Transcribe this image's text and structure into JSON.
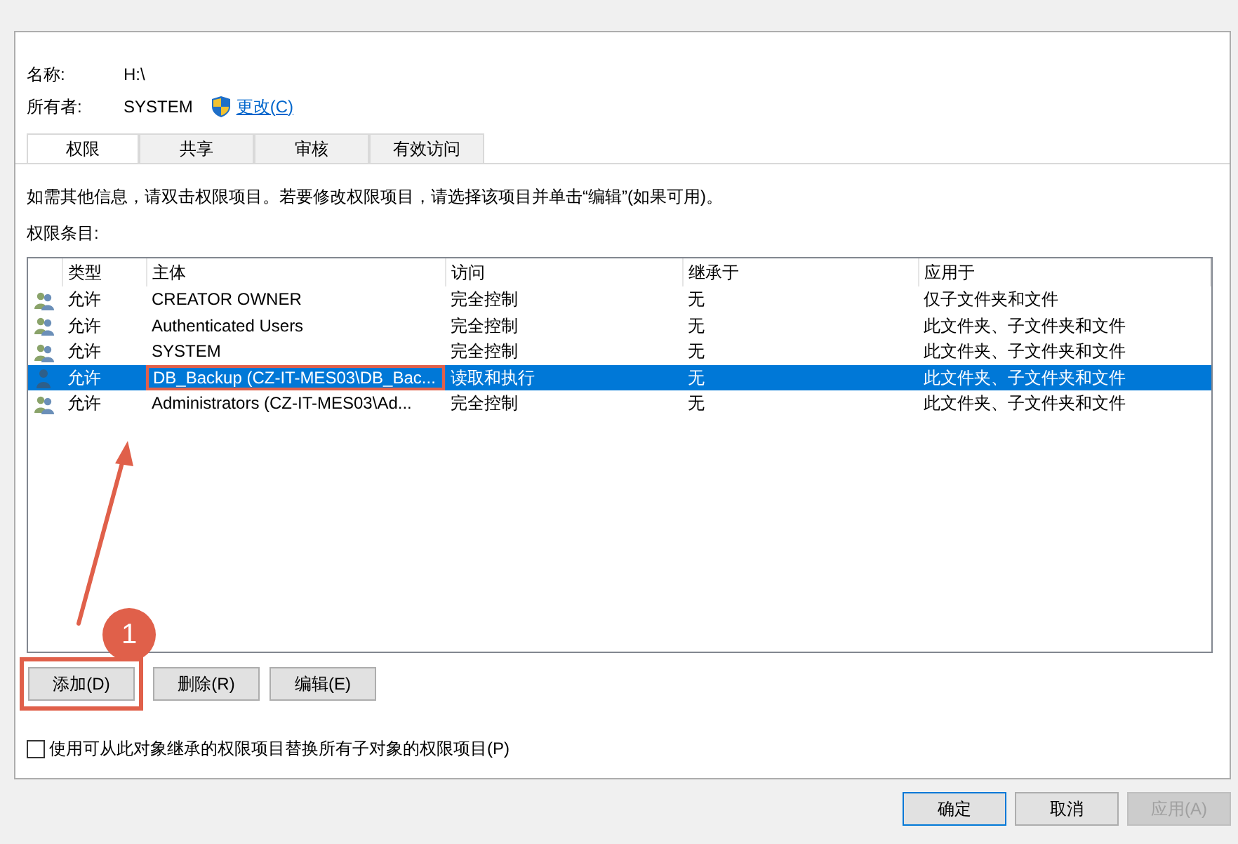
{
  "fields": [
    {
      "label": "名称:",
      "value": "H:\\"
    },
    {
      "label": "所有者:",
      "value": "SYSTEM"
    }
  ],
  "change_link": "更改(C)",
  "tabs": [
    {
      "label": "权限",
      "selected": true
    },
    {
      "label": "共享",
      "selected": false
    },
    {
      "label": "审核",
      "selected": false
    },
    {
      "label": "有效访问",
      "selected": false
    }
  ],
  "info": "如需其他信息，请双击权限项目。若要修改权限项目，请选择该项目并单击“编辑”(如果可用)。",
  "entries_label": "权限条目:",
  "table": {
    "columns": [
      "类型",
      "主体",
      "访问",
      "继承于",
      "应用于"
    ],
    "rows": [
      {
        "kind": "group",
        "type": "允许",
        "principal": "CREATOR OWNER",
        "access": "完全控制",
        "inherited_from": "无",
        "applies_to": "仅子文件夹和文件",
        "selected": false,
        "highlighted": false
      },
      {
        "kind": "group",
        "type": "允许",
        "principal": "Authenticated Users",
        "access": "完全控制",
        "inherited_from": "无",
        "applies_to": "此文件夹、子文件夹和文件",
        "selected": false,
        "highlighted": false
      },
      {
        "kind": "group",
        "type": "允许",
        "principal": "SYSTEM",
        "access": "完全控制",
        "inherited_from": "无",
        "applies_to": "此文件夹、子文件夹和文件",
        "selected": false,
        "highlighted": false
      },
      {
        "kind": "user",
        "type": "允许",
        "principal": "DB_Backup (CZ-IT-MES03\\DB_Bac...",
        "access": "读取和执行",
        "inherited_from": "无",
        "applies_to": "此文件夹、子文件夹和文件",
        "selected": true,
        "highlighted": true
      },
      {
        "kind": "group",
        "type": "允许",
        "principal": "Administrators (CZ-IT-MES03\\Ad...",
        "access": "完全控制",
        "inherited_from": "无",
        "applies_to": "此文件夹、子文件夹和文件",
        "selected": false,
        "highlighted": false
      }
    ]
  },
  "buttons": [
    {
      "label": "添加(D)",
      "highlighted": true
    },
    {
      "label": "删除(R)",
      "highlighted": false
    },
    {
      "label": "编辑(E)",
      "highlighted": false
    }
  ],
  "replace_checkbox": {
    "label": "使用可从此对象继承的权限项目替换所有子对象的权限项目(P)",
    "checked": false
  },
  "dialog_buttons": [
    {
      "label": "确定",
      "kind": "default",
      "disabled": false
    },
    {
      "label": "取消",
      "kind": "normal",
      "disabled": false
    },
    {
      "label": "应用(A)",
      "kind": "normal",
      "disabled": true
    }
  ],
  "annotation": {
    "step": "1"
  }
}
